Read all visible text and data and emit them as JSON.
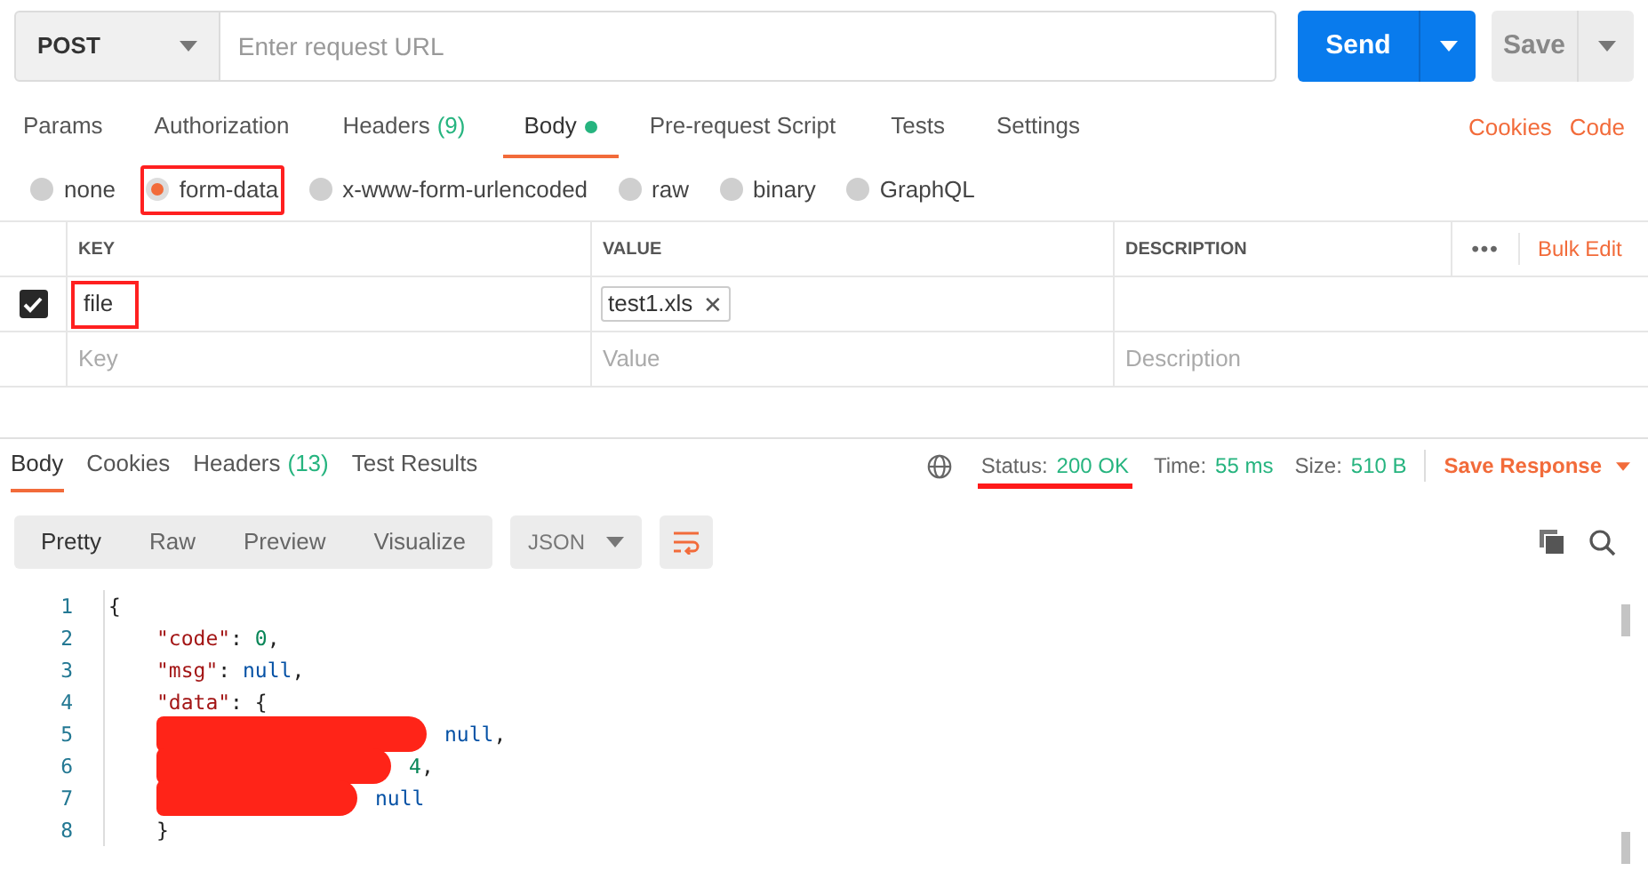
{
  "request": {
    "method": "POST",
    "url_placeholder": "Enter request URL",
    "send": "Send",
    "save": "Save"
  },
  "request_tabs": [
    {
      "label": "Params",
      "dot": false,
      "selected": false
    },
    {
      "label": "Authorization",
      "dot": false,
      "selected": false
    },
    {
      "label": "Headers",
      "count": "(9)",
      "dot": false,
      "selected": false
    },
    {
      "label": "Body",
      "dot": true,
      "selected": true
    },
    {
      "label": "Pre-request Script",
      "dot": false,
      "selected": false
    },
    {
      "label": "Tests",
      "dot": false,
      "selected": false
    },
    {
      "label": "Settings",
      "dot": false,
      "selected": false
    }
  ],
  "links": [
    "Cookies",
    "Code"
  ],
  "body_modes": [
    {
      "label": "none",
      "selected": false,
      "highlighted": false
    },
    {
      "label": "form-data",
      "selected": true,
      "highlighted": true
    },
    {
      "label": "x-www-form-urlencoded",
      "selected": false,
      "highlighted": false
    },
    {
      "label": "raw",
      "selected": false,
      "highlighted": false
    },
    {
      "label": "binary",
      "selected": false,
      "highlighted": false
    },
    {
      "label": "GraphQL",
      "selected": false,
      "highlighted": false
    }
  ],
  "table": {
    "columns": [
      "KEY",
      "VALUE",
      "DESCRIPTION"
    ],
    "more": "•••",
    "bulk_edit": "Bulk Edit",
    "rows": [
      {
        "checked": true,
        "key": "file",
        "key_highlighted": true,
        "file": "test1.xls",
        "remove": "✕"
      }
    ],
    "new_row": [
      {
        "placeholder": "Key"
      },
      {
        "placeholder": "Value"
      },
      {
        "placeholder": "Description"
      }
    ]
  },
  "response_tabs": [
    {
      "label": "Body",
      "selected": true
    },
    {
      "label": "Cookies",
      "selected": false
    },
    {
      "label": "Headers",
      "count": "(13)",
      "selected": false
    },
    {
      "label": "Test Results",
      "selected": false
    }
  ],
  "response_meta": {
    "status_label": "Status:",
    "status": "200 OK",
    "status_underlined": true,
    "time_label": "Time:",
    "time": "55 ms",
    "size_label": "Size:",
    "size": "510 B",
    "save_response": "Save Response"
  },
  "view_modes": [
    {
      "label": "Pretty",
      "selected": true
    },
    {
      "label": "Raw",
      "selected": false
    },
    {
      "label": "Preview",
      "selected": false
    },
    {
      "label": "Visualize",
      "selected": false
    }
  ],
  "format": "JSON",
  "code": [
    {
      "number": "1",
      "tokens": [
        {
          "kind": "punct",
          "text": "{"
        }
      ],
      "redacted": false
    },
    {
      "number": "2",
      "tokens": [
        {
          "kind": "key",
          "text": "\"code\""
        },
        {
          "kind": "punct",
          "text": ": "
        },
        {
          "kind": "number",
          "text": "0"
        },
        {
          "kind": "punct",
          "text": ","
        }
      ],
      "redacted": false
    },
    {
      "number": "3",
      "tokens": [
        {
          "kind": "key",
          "text": "\"msg\""
        },
        {
          "kind": "punct",
          "text": ": "
        },
        {
          "kind": "null",
          "text": "null"
        },
        {
          "kind": "punct",
          "text": ","
        }
      ],
      "redacted": false
    },
    {
      "number": "4",
      "tokens": [
        {
          "kind": "key",
          "text": "\"data\""
        },
        {
          "kind": "punct",
          "text": ": {"
        }
      ],
      "redacted": false
    },
    {
      "number": "5",
      "tokens": [
        {
          "kind": "null",
          "text": "null"
        },
        {
          "kind": "punct",
          "text": ","
        }
      ],
      "redacted": true
    },
    {
      "number": "6",
      "tokens": [
        {
          "kind": "number",
          "text": "4"
        },
        {
          "kind": "punct",
          "text": ","
        }
      ],
      "redacted": true
    },
    {
      "number": "7",
      "tokens": [
        {
          "kind": "null",
          "text": "null"
        }
      ],
      "redacted": true
    },
    {
      "number": "8",
      "tokens": [
        {
          "kind": "punct",
          "text": "}"
        }
      ],
      "redacted": false
    }
  ]
}
